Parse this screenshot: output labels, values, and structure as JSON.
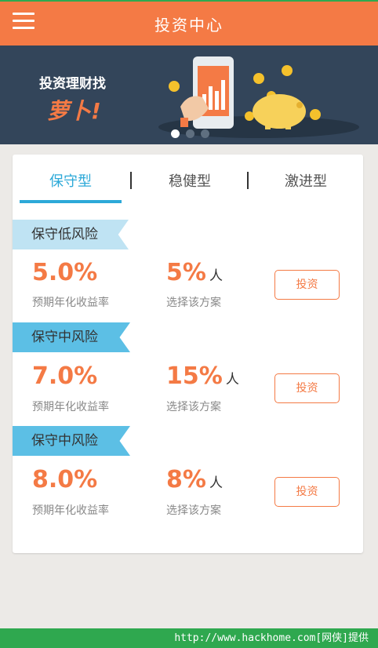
{
  "header": {
    "title": "投资中心",
    "menu_icon": "hamburger-menu-icon"
  },
  "banner": {
    "text": "投资理财找",
    "brand": "萝卜!",
    "slides": 3,
    "active_slide": 1
  },
  "tabs": [
    {
      "label": "保守型",
      "active": true
    },
    {
      "label": "稳健型",
      "active": false
    },
    {
      "label": "激进型",
      "active": false
    }
  ],
  "plans": [
    {
      "risk": "保守低风险",
      "rate": "5.0%",
      "rate_label": "预期年化收益率",
      "pct": "5%",
      "pct_unit": "人",
      "plan_label": "选择该方案",
      "button": "投资"
    },
    {
      "risk": "保守中风险",
      "rate": "7.0%",
      "rate_label": "预期年化收益率",
      "pct": "15%",
      "pct_unit": "人",
      "plan_label": "选择该方案",
      "button": "投资"
    },
    {
      "risk": "保守中风险",
      "rate": "8.0%",
      "rate_label": "预期年化收益率",
      "pct": "8%",
      "pct_unit": "人",
      "plan_label": "选择该方案",
      "button": "投资"
    }
  ],
  "watermark": "http://www.hackhome.com[网侠]提供",
  "colors": {
    "accent": "#f47a45",
    "tab_active": "#2da9d8",
    "banner_bg": "#33455a"
  }
}
